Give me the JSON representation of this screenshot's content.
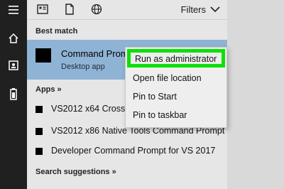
{
  "toolbar": {
    "icons": [
      "app-grid-icon",
      "document-icon",
      "globe-icon"
    ],
    "filters_label": "Filters"
  },
  "rail": {
    "icons": [
      "hamburger-icon",
      "home-icon",
      "contact-card-icon",
      "battery-icon"
    ]
  },
  "best_match": {
    "heading": "Best match",
    "title": "Command Prompt",
    "subtitle": "Desktop app"
  },
  "context_menu": {
    "items": [
      "Run as administrator",
      "Open file location",
      "Pin to Start",
      "Pin to taskbar"
    ],
    "highlight_color": "#0ee007"
  },
  "apps": {
    "heading": "Apps »",
    "items": [
      "VS2012 x64 Cross T",
      "VS2012 x86 Native Tools Command Prompt",
      "Developer Command Prompt for VS 2017"
    ]
  },
  "search_suggestions": {
    "heading": "Search suggestions »"
  },
  "colors": {
    "selected_row": "#8fb3d5",
    "rail": "#202020",
    "panel": "#e6e6e6"
  }
}
